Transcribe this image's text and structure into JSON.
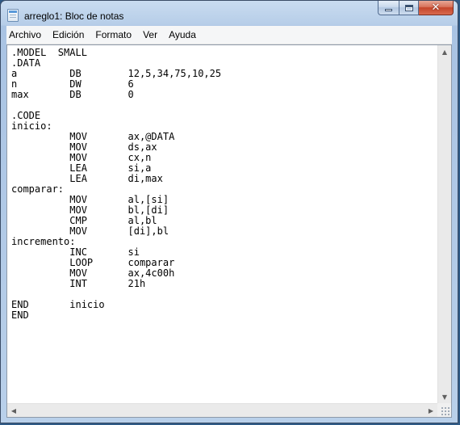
{
  "window": {
    "title": "arreglo1: Bloc de notas",
    "icon": "notepad-icon",
    "controls": {
      "minimize_icon": "minimize-icon",
      "maximize_icon": "maximize-icon",
      "close_glyph": "✕"
    }
  },
  "menu": [
    {
      "label": "Archivo"
    },
    {
      "label": "Edición"
    },
    {
      "label": "Formato"
    },
    {
      "label": "Ver"
    },
    {
      "label": "Ayuda"
    }
  ],
  "editor": {
    "content": ".MODEL  SMALL\n.DATA\na         DB        12,5,34,75,10,25\nn         DW        6\nmax       DB        0\n\n.CODE\ninicio:\n          MOV       ax,@DATA\n          MOV       ds,ax\n          MOV       cx,n\n          LEA       si,a\n          LEA       di,max\ncomparar:\n          MOV       al,[si]\n          MOV       bl,[di]\n          CMP       al,bl\n          MOV       [di],bl\nincremento:\n          INC       si\n          LOOP      comparar\n          MOV       ax,4c00h\n          INT       21h\n\nEND       inicio\nEND"
  },
  "scrollbars": {
    "up_arrow": "▲",
    "down_arrow": "▼",
    "left_arrow": "◀",
    "right_arrow": "▶"
  },
  "colors": {
    "window_frame": "#b9d0ea",
    "close_button": "#c4452a",
    "editor_background": "#ffffff"
  }
}
